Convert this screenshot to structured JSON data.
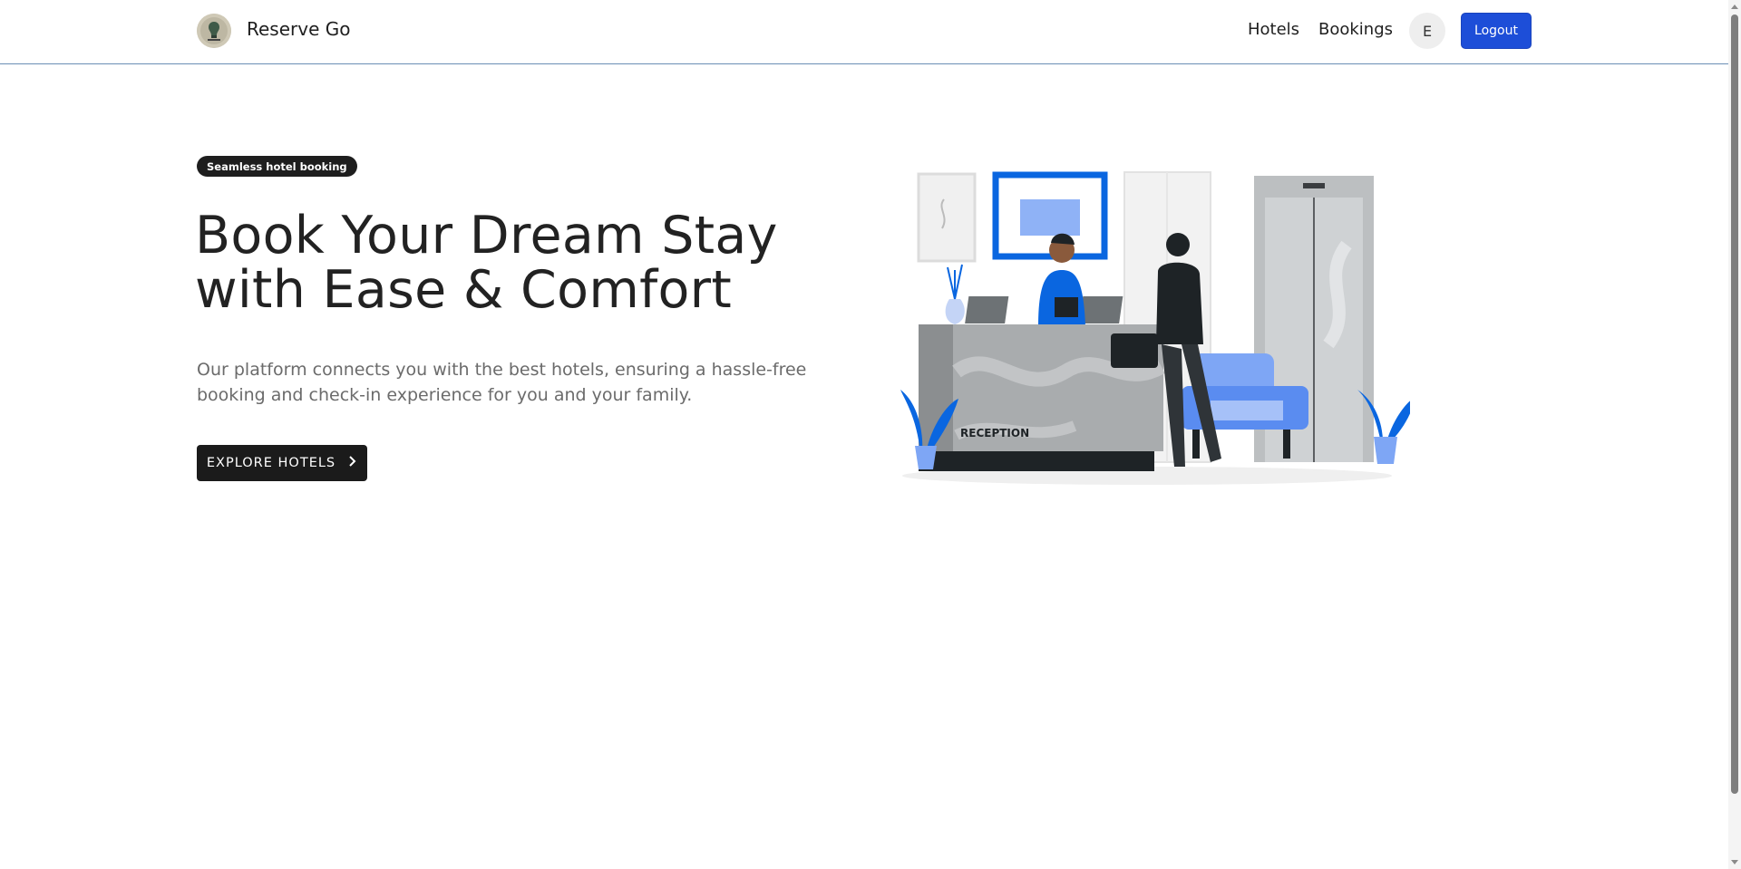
{
  "header": {
    "brand": "Reserve Go",
    "nav": {
      "hotels": "Hotels",
      "bookings": "Bookings"
    },
    "avatar_initial": "E",
    "logout_label": "Logout"
  },
  "hero": {
    "badge": "Seamless hotel booking",
    "headline_line1": "Book Your Dream Stay",
    "headline_line2": "with Ease & Comfort",
    "description": "Our platform connects you with the best hotels, ensuring a hassle-free booking and check-in experience for you and your family.",
    "cta_label": "EXPLORE HOTELS",
    "illustration_sign": "RECEPTION"
  },
  "colors": {
    "accent_blue": "#1d4ed8",
    "illustration_blue": "#0a66e0",
    "light_blue": "#7ea6f5",
    "dark": "#1e1e1e"
  },
  "icons": {
    "cta_arrow": "chevron-right-icon",
    "logo": "logo-icon"
  }
}
